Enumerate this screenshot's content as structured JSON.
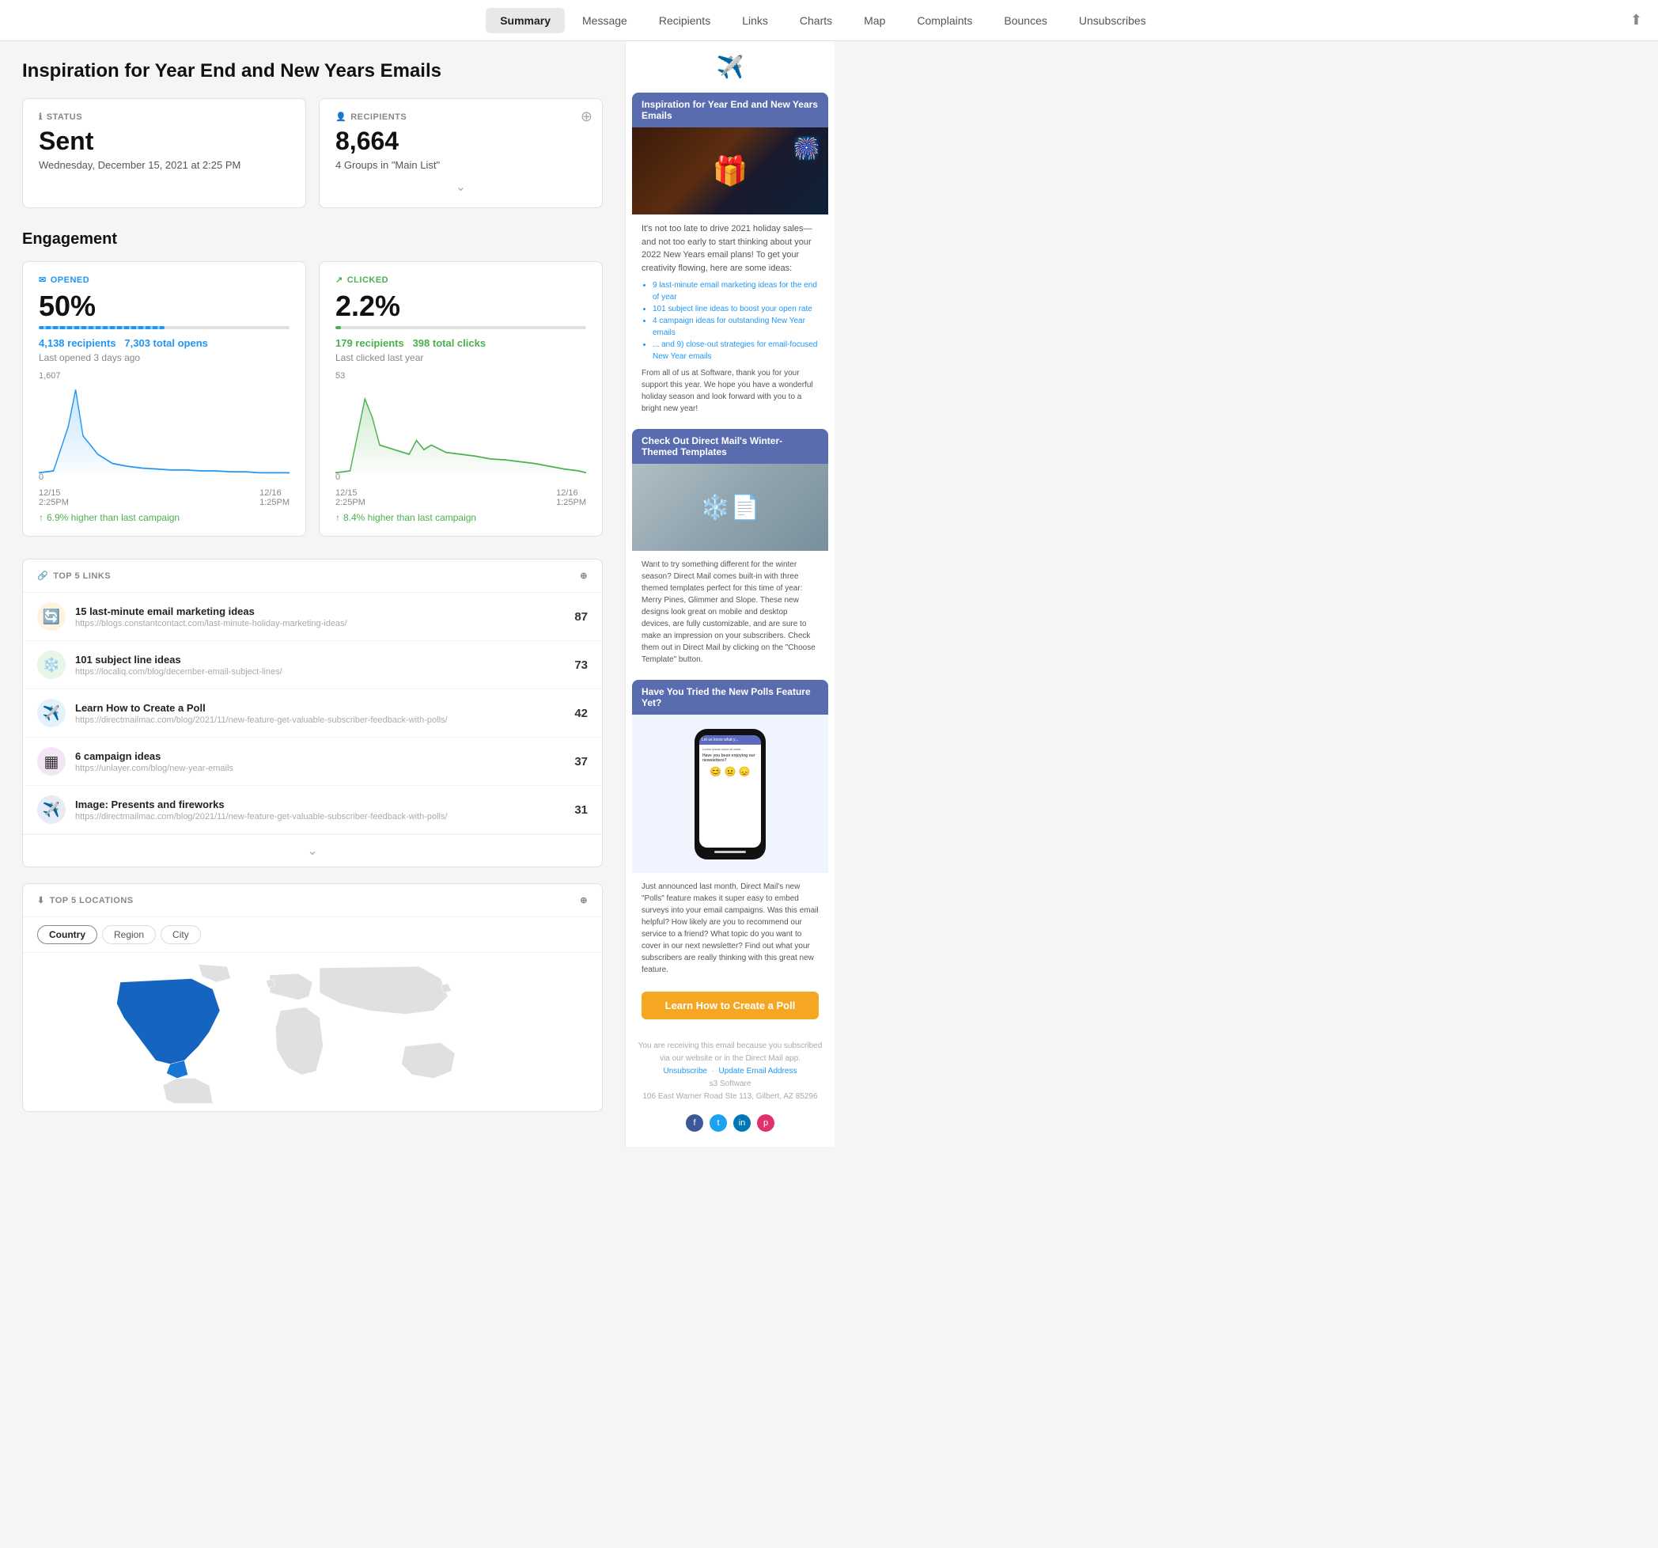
{
  "nav": {
    "tabs": [
      {
        "label": "Summary",
        "active": true
      },
      {
        "label": "Message",
        "active": false
      },
      {
        "label": "Recipients",
        "active": false
      },
      {
        "label": "Links",
        "active": false
      },
      {
        "label": "Charts",
        "active": false
      },
      {
        "label": "Map",
        "active": false
      },
      {
        "label": "Complaints",
        "active": false
      },
      {
        "label": "Bounces",
        "active": false
      },
      {
        "label": "Unsubscribes",
        "active": false
      }
    ]
  },
  "page": {
    "title": "Inspiration for Year End and New Years Emails"
  },
  "status": {
    "label": "STATUS",
    "value": "Sent",
    "date": "Wednesday, December 15, 2021 at 2:25 PM"
  },
  "recipients": {
    "label": "RECIPIENTS",
    "value": "8,664",
    "sub": "4 Groups in \"Main List\""
  },
  "engagement": {
    "title": "Engagement",
    "opened": {
      "label": "OPENED",
      "percent": "50%",
      "recipients": "4,138 recipients",
      "total": "7,303 total opens",
      "last": "Last opened 3 days ago",
      "higher": "6.9% higher than last campaign",
      "ymax": "1,607",
      "yzero": "0",
      "xstart": "12/15\n2:25PM",
      "xend": "12/16\n1:25PM",
      "bar_width_pct": 50
    },
    "clicked": {
      "label": "CLICKED",
      "percent": "2.2%",
      "recipients": "179 recipients",
      "total": "398 total clicks",
      "last": "Last clicked last year",
      "higher": "8.4% higher than last campaign",
      "ymax": "53",
      "yzero": "0",
      "xstart": "12/15\n2:25PM",
      "xend": "12/16\n1:25PM"
    }
  },
  "top_links": {
    "label": "TOP 5 LINKS",
    "items": [
      {
        "icon": "🔄",
        "icon_bg": "#fff3e0",
        "title": "15 last-minute email marketing ideas",
        "url": "https://blogs.constantcontact.com/last-minute-holiday-marketing-ideas/",
        "count": "87"
      },
      {
        "icon": "❄️",
        "icon_bg": "#e8f5e9",
        "title": "101 subject line ideas",
        "url": "https://localiq.com/blog/december-email-subject-lines/",
        "count": "73"
      },
      {
        "icon": "✈️",
        "icon_bg": "#e3f2fd",
        "title": "Learn How to Create a Poll",
        "url": "https://directmailmac.com/blog/2021/11/new-feature-get-valuable-subscriber-feedback-with-polls/",
        "count": "42"
      },
      {
        "icon": "▦",
        "icon_bg": "#f3e5f5",
        "title": "6 campaign ideas",
        "url": "https://unlayer.com/blog/new-year-emails",
        "count": "37"
      },
      {
        "icon": "✈️",
        "icon_bg": "#e8eaf6",
        "title": "Image: Presents and fireworks",
        "url": "https://directmailmac.com/blog/2021/11/new-feature-get-valuable-subscriber-feedback-with-polls/",
        "count": "31"
      }
    ]
  },
  "top_locations": {
    "label": "TOP 5 LOCATIONS",
    "tabs": [
      "Country",
      "Region",
      "City"
    ]
  },
  "sidebar": {
    "send_icon": "✈️",
    "promos": [
      {
        "header": "Inspiration for Year End and New Years Emails",
        "body": "It's not too late to drive 2021 holiday sales—and not too early to start thinking about your 2022 New Years email plans! To get your creativity flowing, here are some ideas:",
        "bullets": [
          "9 last-minute email marketing ideas for the end of year",
          "101 subject line ideas to boost your open rate",
          "4 campaign ideas for outstanding New Year emails",
          "... and 9) close-out strategies for email-focused New Year emails"
        ],
        "footer": "From all of us at Software, thank you for your support this year. We hope you have a wonderful holiday season and look forward with you to a bright new year!"
      },
      {
        "header": "Check Out Direct Mail's Winter-Themed Templates",
        "body": "Want to try something different for the winter season? Direct Mail comes built-in with three themed templates perfect for this time of year: Merry Pines, Glimmer and Slope. These new designs look great on mobile and desktop devices, are fully customizable, and are sure to make an impression on your subscribers. Check them out in Direct Mail by clicking on the \"Choose Template\" button."
      },
      {
        "header": "Have You Tried the New Polls Feature Yet?",
        "body": "Just announced last month, Direct Mail's new \"Polls\" feature makes it super easy to embed surveys into your email campaigns. Was this email helpful? How likely are you to recommend our service to a friend? What topic do you want to cover in our next newsletter? Find out what your subscribers are really thinking with this great new feature.",
        "cta": "Learn How to Create a Poll"
      }
    ],
    "footer": {
      "receiving": "You are receiving this email because you subscribed via our website or in the Direct Mail app.",
      "links": [
        "Unsubscribe",
        "Update Email Address"
      ],
      "company": "s3 Software",
      "address": "106 East Warner Road Ste 113, Gilbert, AZ 85296"
    },
    "social": [
      "f",
      "t",
      "in",
      "p"
    ]
  }
}
